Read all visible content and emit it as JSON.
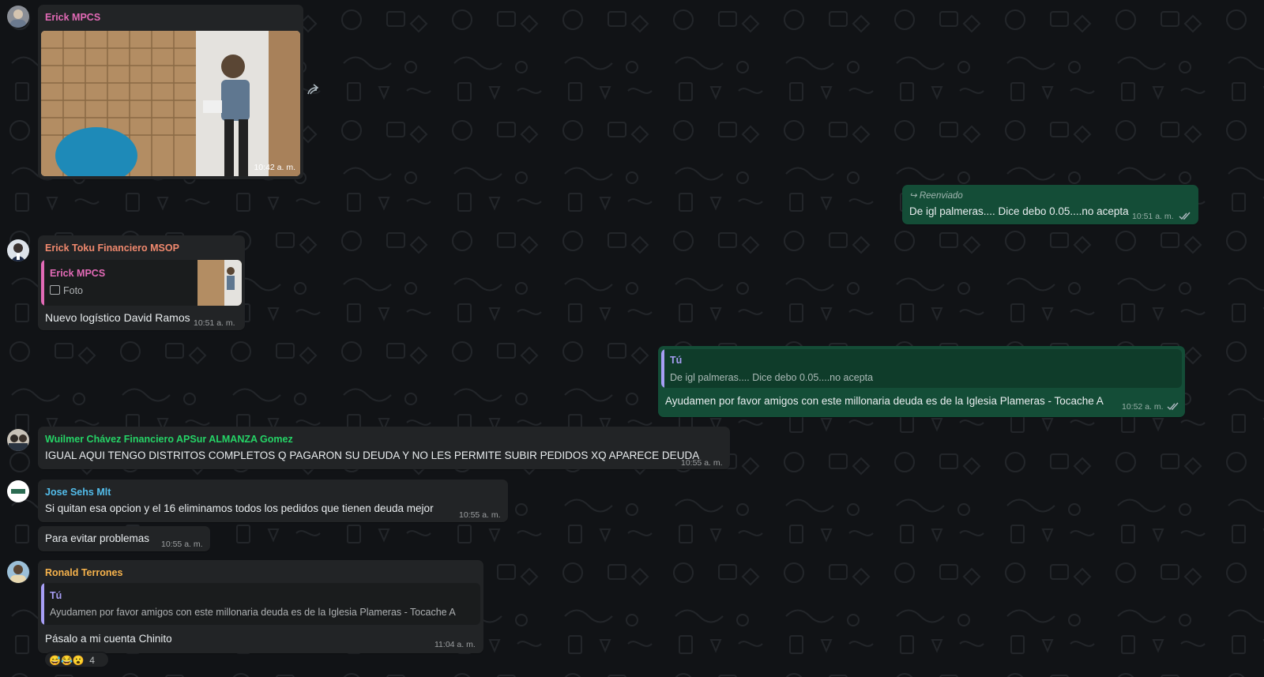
{
  "colors": {
    "background": "#111316",
    "incoming_bubble": "#222426",
    "outgoing_bubble": "#144d37",
    "name_erick_mpcs": "#e26ab6",
    "name_erick_toku": "#f0896e",
    "name_wuilmer": "#25d366",
    "name_jose": "#53bdeb",
    "name_ronald": "#f7b34c",
    "name_tu": "#a79ef5"
  },
  "messages": {
    "m1": {
      "sender": "Erick MPCS",
      "media_type": "photo",
      "time": "10:42 a. m.",
      "forward_icon": "forward-icon"
    },
    "m2": {
      "forwarded_label": "Reenviado",
      "text": "De igl palmeras.... Dice debo 0.05....no acepta",
      "time": "10:51 a. m.",
      "status": "read-double-check"
    },
    "m3": {
      "sender": "Erick Toku Financiero MSOP",
      "quote_author": "Erick MPCS",
      "quote_type": "Foto",
      "text": "Nuevo logístico David Ramos",
      "time": "10:51 a. m."
    },
    "m4": {
      "quote_author": "Tú",
      "quote_text": "De igl palmeras.... Dice debo 0.05....no acepta",
      "text": "Ayudamen por favor amigos con este millonaria deuda es de la Iglesia Plameras - Tocache A",
      "time": "10:52 a. m.",
      "status": "read-double-check"
    },
    "m5": {
      "sender": "Wuilmer Chávez Financiero APSur ALMANZA Gomez",
      "text": "IGUAL AQUI TENGO DISTRITOS COMPLETOS Q PAGARON SU DEUDA Y NO LES PERMITE SUBIR PEDIDOS XQ APARECE DEUDA",
      "time": "10:55 a. m."
    },
    "m6": {
      "sender": "Jose Sehs Mlt",
      "text": "Si quitan esa opcion y el 16 eliminamos todos los pedidos que tienen deuda mejor",
      "time": "10:55 a. m."
    },
    "m7": {
      "text": "Para evitar problemas",
      "time": "10:55 a. m."
    },
    "m8": {
      "sender": "Ronald Terrones",
      "quote_author": "Tú",
      "quote_text": "Ayudamen por favor amigos con este millonaria deuda es de la Iglesia Plameras - Tocache A",
      "text": "Pásalo a mi cuenta Chinito",
      "time": "11:04 a. m.",
      "reactions": [
        "😅",
        "😂",
        "😮"
      ],
      "reaction_count": "4"
    }
  }
}
